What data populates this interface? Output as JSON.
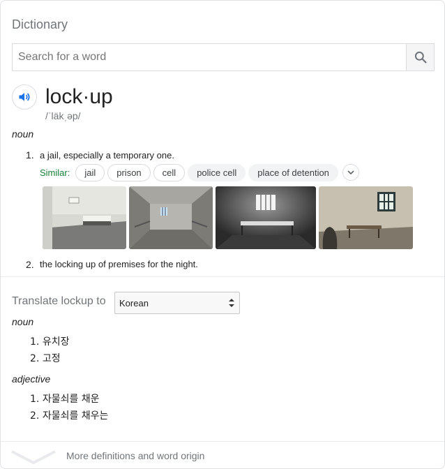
{
  "header": {
    "title": "Dictionary"
  },
  "search": {
    "placeholder": "Search for a word",
    "icon": "search-icon"
  },
  "entry": {
    "word": "lock·up",
    "phonetic": "/ˈläkˌəp/",
    "pos_noun": "noun",
    "definitions": [
      {
        "num": "1.",
        "text": "a jail, especially a temporary one."
      },
      {
        "num": "2.",
        "text": "the locking up of premises for the night."
      }
    ],
    "similar_label": "Similar:",
    "similar": [
      "jail",
      "prison",
      "cell",
      "police cell",
      "place of detention"
    ],
    "accent_color": "#1a73e8",
    "similar_color": "#188038"
  },
  "translate": {
    "label": "Translate lockup to",
    "language": "Korean",
    "noun_label": "noun",
    "noun_items": [
      {
        "num": "1.",
        "text": "유치장"
      },
      {
        "num": "2.",
        "text": "고정"
      }
    ],
    "adjective_label": "adjective",
    "adjective_items": [
      {
        "num": "1.",
        "text": "자물쇠를 채운"
      },
      {
        "num": "2.",
        "text": "자물쇠를 채우는"
      }
    ]
  },
  "footer": {
    "more_label": "More definitions and word origin"
  }
}
